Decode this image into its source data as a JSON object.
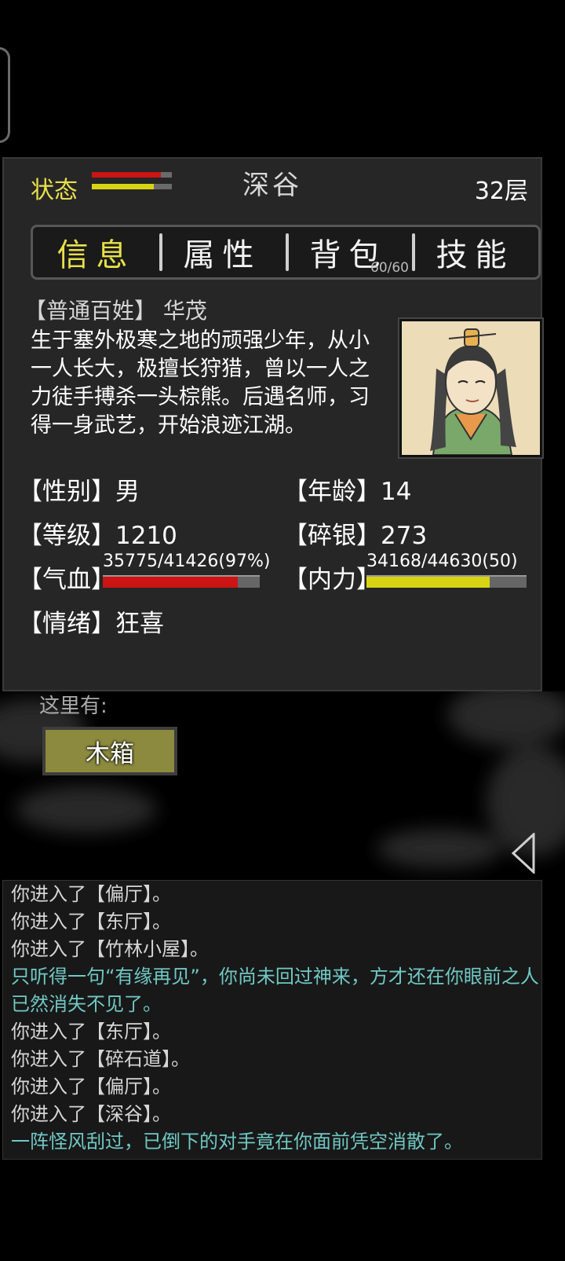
{
  "status": {
    "label": "状态",
    "hp_level": 0.86,
    "mp_level": 0.77
  },
  "location": "深谷",
  "floor": "32层",
  "tabs": [
    {
      "label": "信息",
      "badge": ""
    },
    {
      "label": "属性",
      "badge": ""
    },
    {
      "label": "背包",
      "badge": "60/60"
    },
    {
      "label": "技能",
      "badge": ""
    }
  ],
  "character": {
    "title": "【普通百姓】 华茂",
    "bio": "生于塞外极寒之地的顽强少年，从小一人长大，极擅长狩猎，曾以一人之力徒手搏杀一头棕熊。后遇名师，习得一身武艺，开始浪迹江湖。",
    "gender_key": "【性别】",
    "gender": "男",
    "age_key": "【年龄】",
    "age": "14",
    "level_key": "【等级】",
    "level": "1210",
    "silver_key": "【碎银】",
    "silver": "273",
    "hp_key": "【气血】",
    "hp_text": "35775/41426(97%)",
    "hp_fraction": 0.86,
    "mp_key": "【内力】",
    "mp_text": "34168/44630(50)",
    "mp_fraction": 0.77,
    "mood_key": "【情绪】",
    "mood": "狂喜"
  },
  "here": {
    "label": "这里有:",
    "items": [
      "木箱"
    ]
  },
  "log": [
    {
      "text": "你进入了【偏厅】。",
      "style": "normal"
    },
    {
      "text": "你进入了【东厅】。",
      "style": "normal"
    },
    {
      "text": "你进入了【竹林小屋】。",
      "style": "normal"
    },
    {
      "text": "只听得一句“有缘再见”，你尚未回过神来，方才还在你眼前之人已然消失不见了。",
      "style": "teal"
    },
    {
      "text": "你进入了【东厅】。",
      "style": "normal"
    },
    {
      "text": "你进入了【碎石道】。",
      "style": "normal"
    },
    {
      "text": "你进入了【偏厅】。",
      "style": "normal"
    },
    {
      "text": "你进入了【深谷】。",
      "style": "normal"
    },
    {
      "text": "一阵怪风刮过，已倒下的对手竟在你面前凭空消散了。",
      "style": "teal"
    }
  ],
  "colors": {
    "accent": "#e8e04a",
    "hp": "#cc1414",
    "mp": "#d8d414",
    "log_event": "#6fc8c4"
  }
}
